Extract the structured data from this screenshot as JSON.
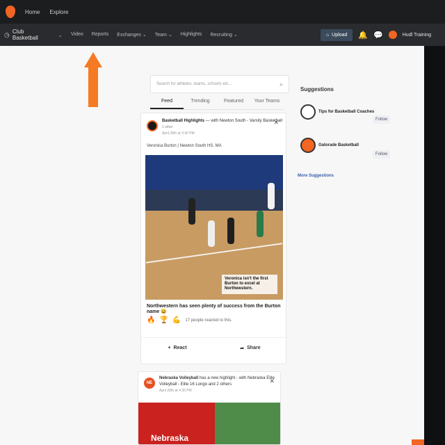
{
  "topbar": {
    "links": [
      "Home",
      "Explore"
    ]
  },
  "nav": {
    "team": "Club Basketball",
    "links": [
      "Video",
      "Reports",
      "Exchanges",
      "Team",
      "Highlights",
      "Recruiting"
    ],
    "upload_label": "Upload",
    "user_name": "Hudl Training"
  },
  "feed": {
    "search_placeholder": "Search for athletes, teams, schools etc...",
    "tabs": [
      "Feed",
      "Trending",
      "Featured",
      "Your Teams"
    ],
    "post1": {
      "author": "Basketball Highlights",
      "with_text": "with Newton South - Varsity Basketball",
      "other_text": "1 other",
      "meta": "April 28th at 3:30 PM",
      "caption": "Veronica Burton | Newton South HS, MA",
      "overlay": "Veronica isn't the first Burton to excel at Northwestern.",
      "text": "Northwestern has seen plenty of success from the Burton name 😄",
      "reactions_text": "17 people reacted to this.",
      "react_label": "React",
      "share_label": "Share"
    },
    "post2": {
      "author": "Nebraska Volleyball",
      "line1_rest": "has a new highlight - with Nebraska Elite",
      "line2": "Volleyball - Elite 16 Longo and 2 others",
      "meta": "April 28th at 4:30 PM",
      "logo_text": "NE",
      "banner": "Nebraska"
    }
  },
  "suggestions": {
    "title": "Suggestions",
    "items": [
      {
        "name": "Tips for Basketball Coaches",
        "follow": "Follow"
      },
      {
        "name": "Gatorade Basketball",
        "follow": "Follow"
      }
    ],
    "more": "More Suggestions"
  },
  "colors": {
    "brand_orange": "#f26522",
    "arrow": "#f57a23"
  }
}
